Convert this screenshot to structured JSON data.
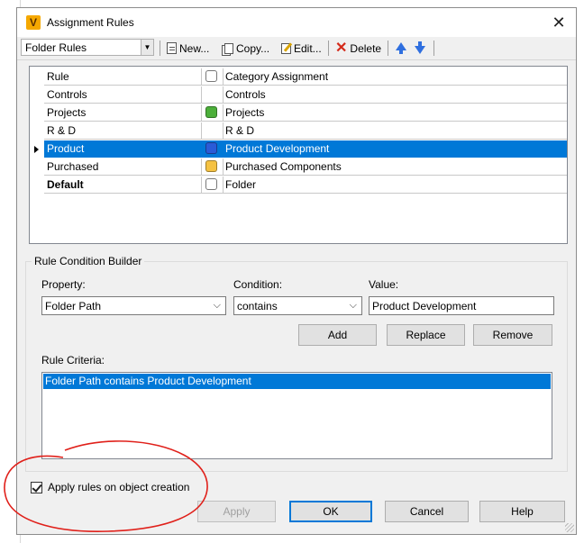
{
  "window": {
    "title": "Assignment Rules",
    "logo_letter": "V",
    "close_glyph": "✕"
  },
  "toolbar": {
    "rule_set": "Folder Rules",
    "new_label": "New...",
    "copy_label": "Copy...",
    "edit_label": "Edit...",
    "delete_label": "Delete"
  },
  "grid": {
    "header": {
      "rule": "Rule",
      "category": "Category Assignment"
    },
    "rows": [
      {
        "rule": "Controls",
        "category": "Controls",
        "color": "",
        "selected": false,
        "bold": false
      },
      {
        "rule": "Projects",
        "category": "Projects",
        "color": "#4caf3a",
        "selected": false,
        "bold": false
      },
      {
        "rule": "R & D",
        "category": "R & D",
        "color": "",
        "selected": false,
        "bold": false
      },
      {
        "rule": "Product",
        "category": "Product Development",
        "color": "#2a5bd7",
        "selected": true,
        "bold": false
      },
      {
        "rule": "Purchased",
        "category": "Purchased Components",
        "color": "#f5c242",
        "selected": false,
        "bold": false
      },
      {
        "rule": "Default",
        "category": "Folder",
        "color": "#ffffff",
        "selected": false,
        "bold": true
      }
    ]
  },
  "builder": {
    "title": "Rule Condition Builder",
    "property_label": "Property:",
    "property_value": "Folder Path",
    "condition_label": "Condition:",
    "condition_value": "contains",
    "value_label": "Value:",
    "value_text": "Product Development",
    "add_label": "Add",
    "replace_label": "Replace",
    "remove_label": "Remove",
    "criteria_label": "Rule Criteria:",
    "criteria_items": [
      "Folder Path contains Product Development"
    ]
  },
  "footer": {
    "apply_on_create_label": "Apply rules on object creation",
    "apply_on_create_checked": true,
    "apply_label": "Apply",
    "ok_label": "OK",
    "cancel_label": "Cancel",
    "help_label": "Help"
  },
  "colors": {
    "selection": "#0078d7",
    "annotation": "#e0201a"
  }
}
